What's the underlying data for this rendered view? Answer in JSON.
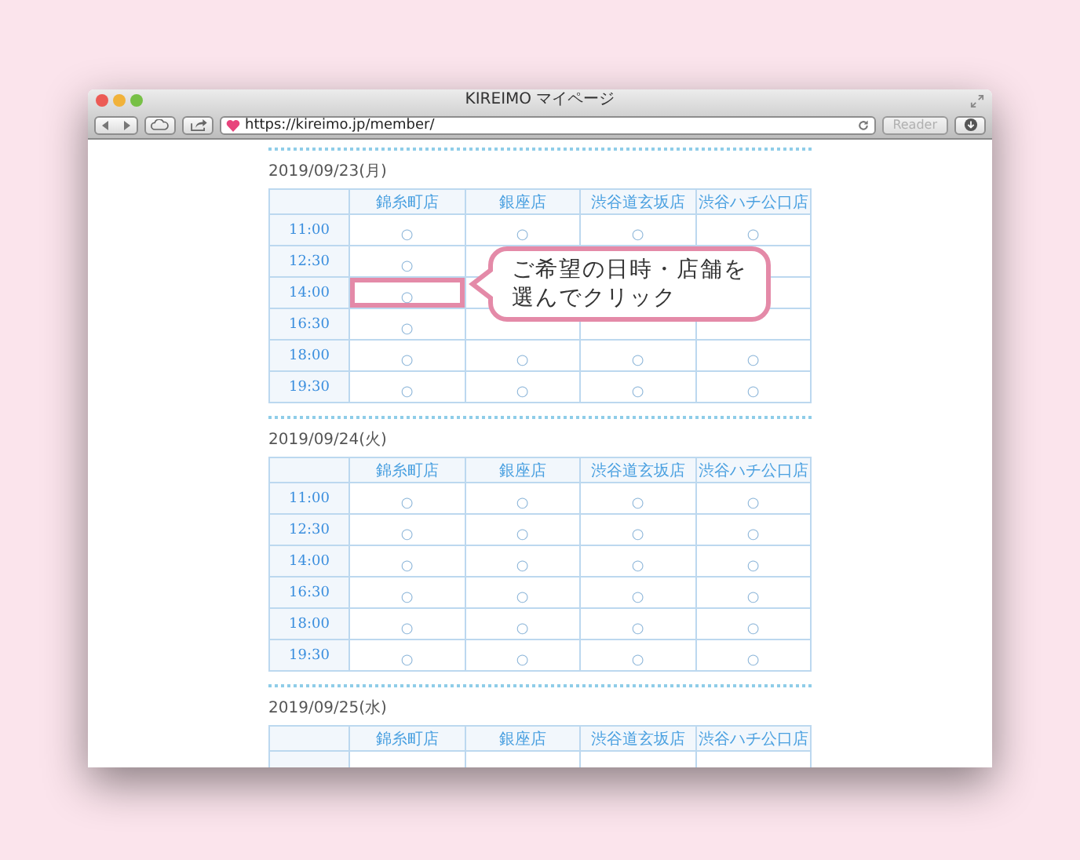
{
  "window": {
    "title": "KIREIMO マイページ",
    "url": "https://kireimo.jp/member/",
    "reader_button": {
      "label": "Reader",
      "disabled": true
    }
  },
  "callout": {
    "lines": [
      "ご希望の日時・店舗を",
      "選んでクリック"
    ]
  },
  "days": [
    {
      "date": "2019/09/23(月)",
      "stores": [
        "錦糸町店",
        "銀座店",
        "渋谷道玄坂店",
        "渋谷ハチ公口店"
      ],
      "rows": [
        {
          "time": "11:00",
          "marks": [
            "○",
            "○",
            "○",
            "○"
          ]
        },
        {
          "time": "12:30",
          "marks": [
            "○"
          ]
        },
        {
          "time": "14:00",
          "marks": [
            "○"
          ],
          "highlighted": true
        },
        {
          "time": "16:30",
          "marks": [
            "○"
          ]
        },
        {
          "time": "18:00",
          "marks": [
            "○",
            "○",
            "○",
            "○"
          ]
        },
        {
          "time": "19:30",
          "marks": [
            "○",
            "○",
            "○",
            "○"
          ]
        }
      ]
    },
    {
      "date": "2019/09/24(火)",
      "stores": [
        "錦糸町店",
        "銀座店",
        "渋谷道玄坂店",
        "渋谷ハチ公口店"
      ],
      "rows": [
        {
          "time": "11:00",
          "marks": [
            "○",
            "○",
            "○",
            "○"
          ]
        },
        {
          "time": "12:30",
          "marks": [
            "○",
            "○",
            "○",
            "○"
          ]
        },
        {
          "time": "14:00",
          "marks": [
            "○",
            "○",
            "○",
            "○"
          ]
        },
        {
          "time": "16:30",
          "marks": [
            "○",
            "○",
            "○",
            "○"
          ]
        },
        {
          "time": "18:00",
          "marks": [
            "○",
            "○",
            "○",
            "○"
          ]
        },
        {
          "time": "19:30",
          "marks": [
            "○",
            "○",
            "○",
            "○"
          ]
        }
      ]
    },
    {
      "date": "2019/09/25(水)",
      "stores": [
        "錦糸町店",
        "銀座店",
        "渋谷道玄坂店",
        "渋谷ハチ公口店"
      ],
      "rows": [
        {
          "marks": []
        }
      ]
    }
  ]
}
